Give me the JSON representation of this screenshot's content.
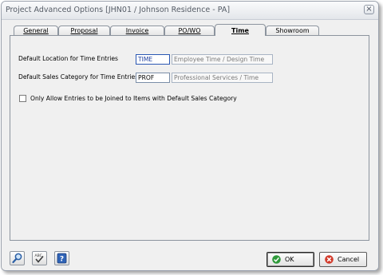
{
  "window": {
    "title": "Project Advanced Options [JHN01 / Johnson Residence - PA]"
  },
  "tabs": [
    {
      "label": "General",
      "active": false
    },
    {
      "label": "Proposal",
      "active": false
    },
    {
      "label": "Invoice",
      "active": false
    },
    {
      "label": "PO/WO",
      "active": false
    },
    {
      "label": "Time",
      "active": true
    },
    {
      "label": "Showroom",
      "active": false
    }
  ],
  "time_tab": {
    "location_label": "Default Location for Time Entries",
    "location_code": "TIME",
    "location_desc": "Employee Time / Design Time",
    "category_label": "Default Sales Category for Time Entries",
    "category_code": "PROF",
    "category_desc": "Professional Services / Time",
    "restrict_label": "Only Allow Entries to be Joined to Items with Default Sales Category",
    "restrict_checked": false
  },
  "footer": {
    "icons": [
      "search-icon",
      "spellcheck-icon",
      "help-icon"
    ],
    "ok_label": "OK",
    "cancel_label": "Cancel"
  }
}
